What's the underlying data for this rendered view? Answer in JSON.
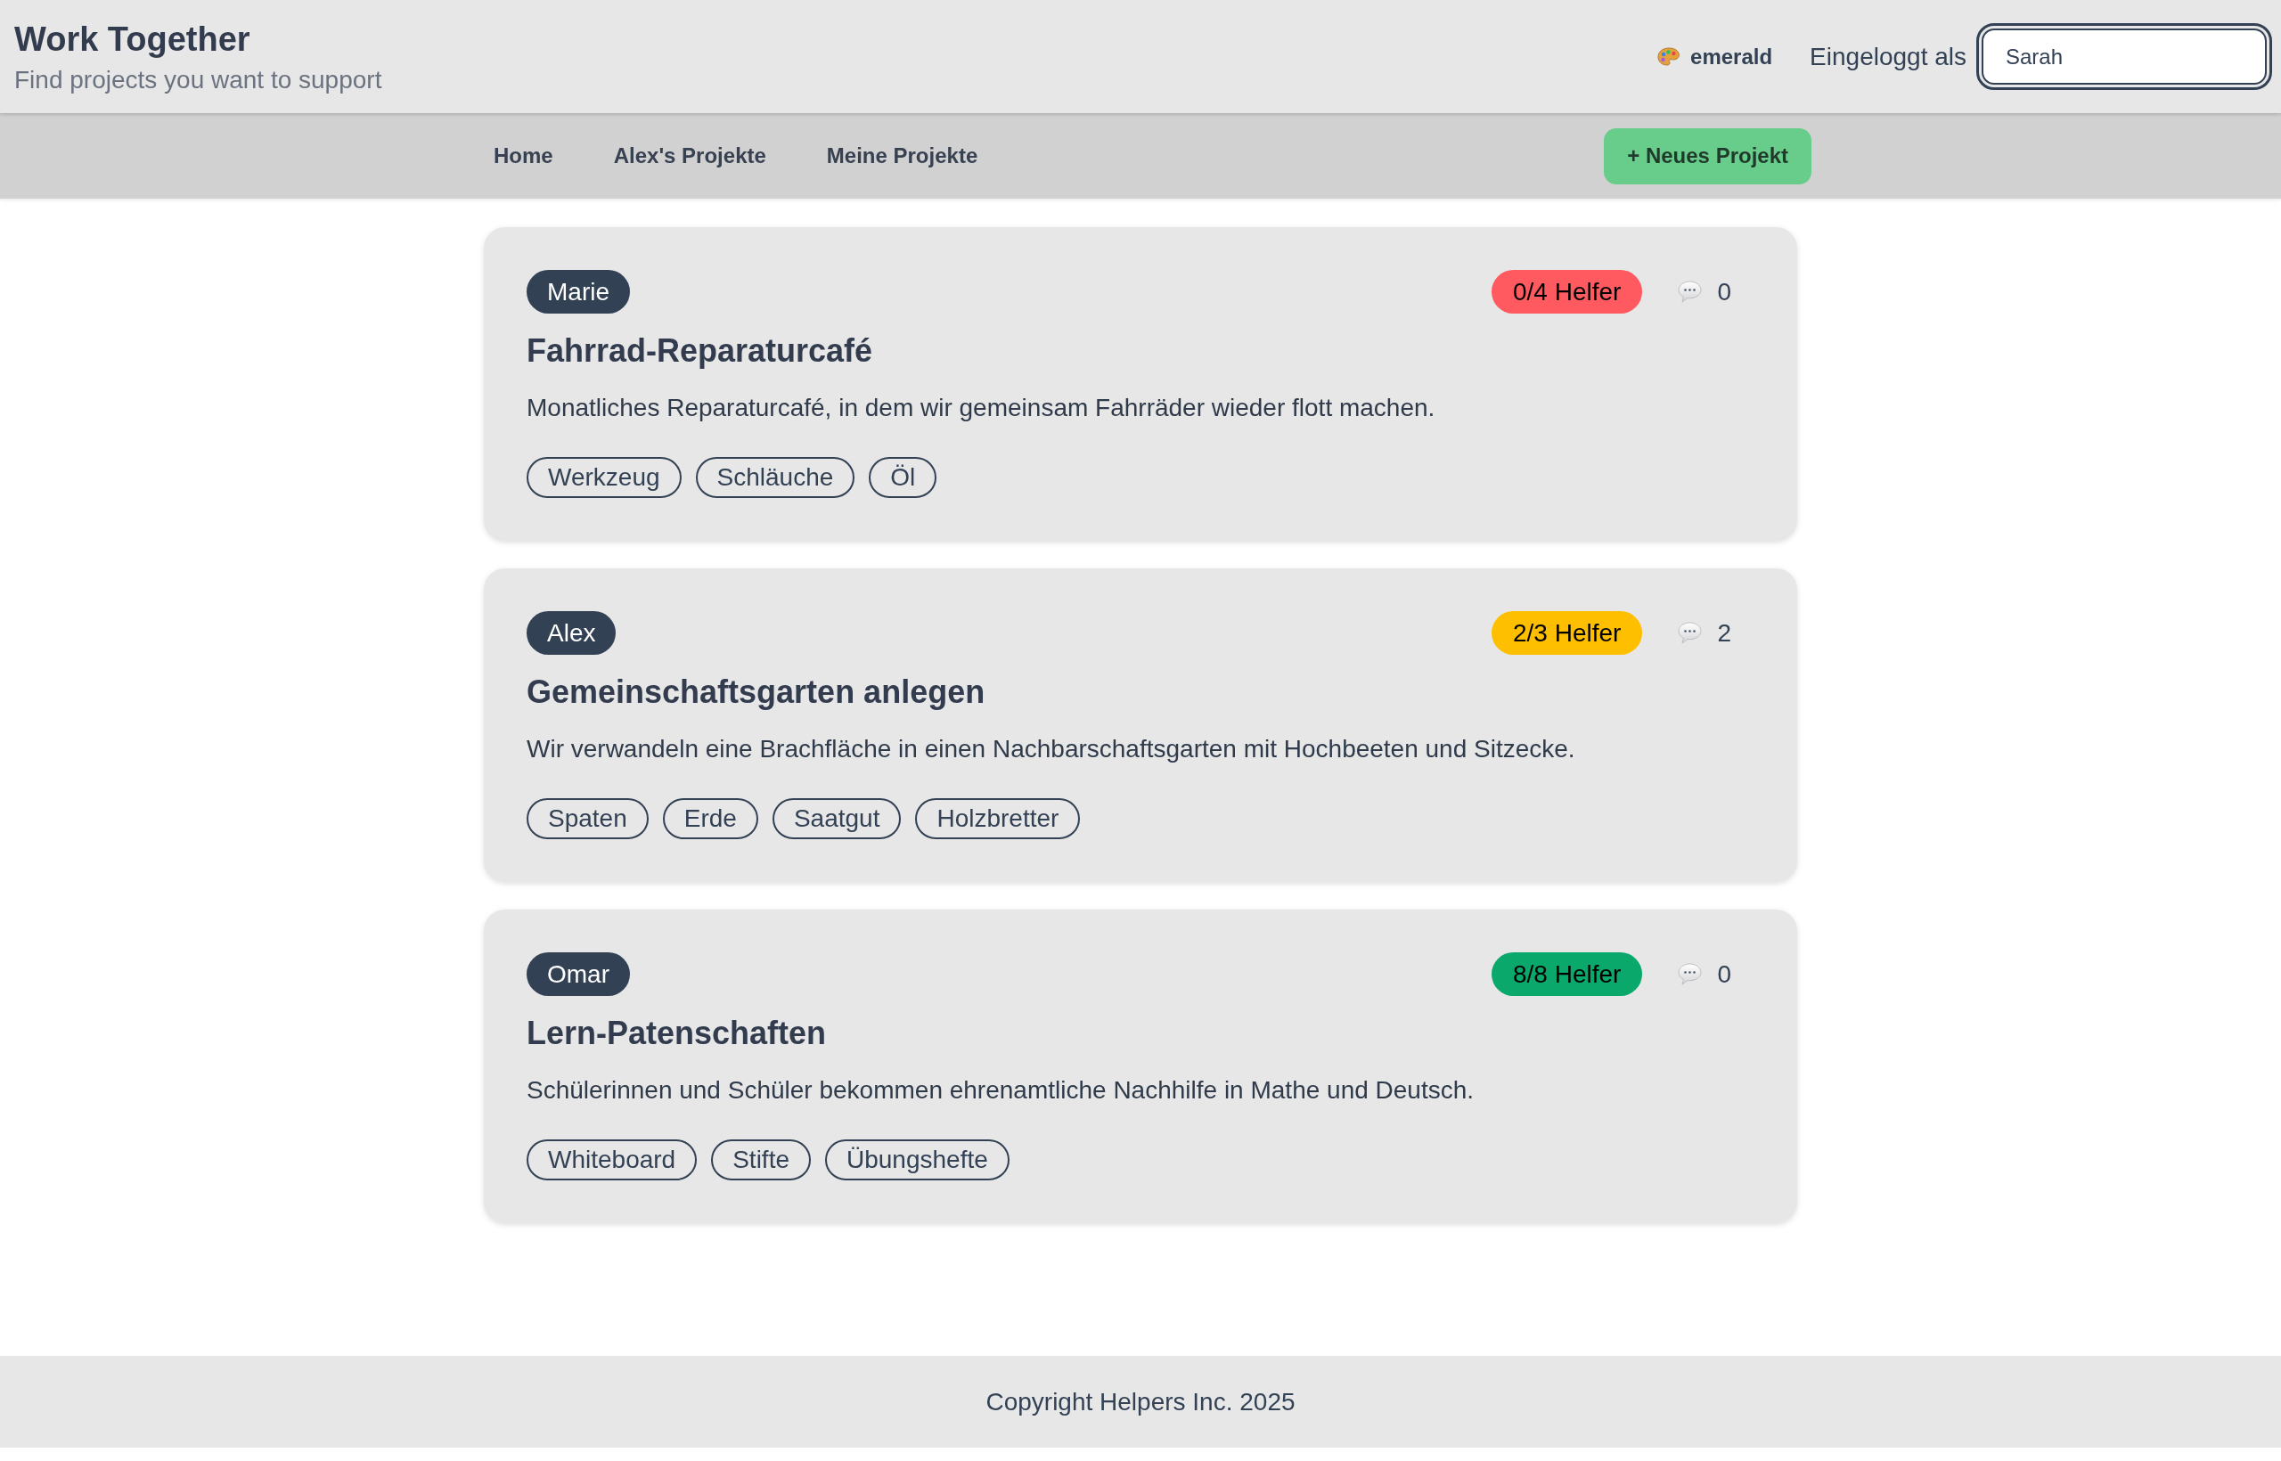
{
  "header": {
    "title": "Work Together",
    "subtitle": "Find projects you want to support"
  },
  "theme_switcher": {
    "label": "emerald"
  },
  "login": {
    "label": "Eingeloggt als",
    "value": "Sarah",
    "focused": true
  },
  "nav": {
    "links": [
      "Home",
      "Alex's Projekte",
      "Meine Projekte"
    ],
    "new_project_button": "+ Neues Projekt"
  },
  "projects": [
    {
      "author": "Marie",
      "helpers": {
        "text": "0/4 Helfer",
        "color": "#fe5a60"
      },
      "comments": "0",
      "title": "Fahrrad-Reparaturcafé",
      "description": "Monatliches Reparaturcafé, in dem wir gemeinsam Fahrräder wieder flott machen.",
      "tags": [
        "Werkzeug",
        "Schläuche",
        "Öl"
      ]
    },
    {
      "author": "Alex",
      "helpers": {
        "text": "2/3 Helfer",
        "color": "#fdbf00"
      },
      "comments": "2",
      "title": "Gemeinschaftsgarten anlegen",
      "description": "Wir verwandeln eine Brachfläche in einen Nachbarschaftsgarten mit Hochbeeten und Sitzecke.",
      "tags": [
        "Spaten",
        "Erde",
        "Saatgut",
        "Holzbretter"
      ]
    },
    {
      "author": "Omar",
      "helpers": {
        "text": "8/8 Helfer",
        "color": "#0aa86b"
      },
      "comments": "0",
      "title": "Lern-Patenschaften",
      "description": "Schülerinnen und Schüler bekommen ehrenamtliche Nachhilfe in Mathe und Deutsch.",
      "tags": [
        "Whiteboard",
        "Stifte",
        "Übungshefte"
      ]
    }
  ],
  "footer": {
    "text": "Copyright Helpers Inc. 2025"
  }
}
